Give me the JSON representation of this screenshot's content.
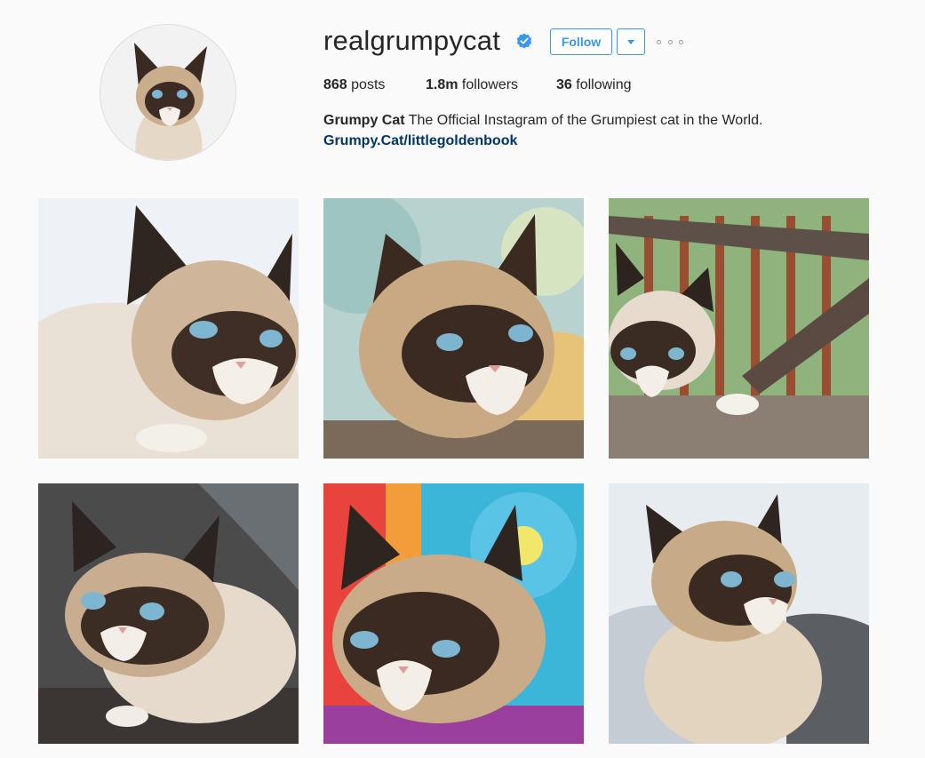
{
  "profile": {
    "username": "realgrumpycat",
    "verified": true,
    "follow_label": "Follow",
    "dropdown_icon": "caret-down-icon",
    "more_icon": "more-options-icon",
    "stats": {
      "posts_count": "868",
      "posts_label": "posts",
      "followers_count": "1.8m",
      "followers_label": "followers",
      "following_count": "36",
      "following_label": "following"
    },
    "bio_name": "Grumpy Cat",
    "bio_text": "The Official Instagram of the Grumpiest cat in the World.",
    "bio_link": "Grumpy.Cat/littlegoldenbook"
  },
  "colors": {
    "accent": "#3897f0",
    "link": "#003569",
    "verified_badge": "#3897f0",
    "text": "#262626",
    "background": "#fafafa"
  },
  "posts": [
    {
      "background": "sky-light"
    },
    {
      "background": "colorful-blur"
    },
    {
      "background": "wooden-fence-green"
    },
    {
      "background": "dark-fabric"
    },
    {
      "background": "tie-dye"
    },
    {
      "background": "grey-blanket"
    }
  ]
}
